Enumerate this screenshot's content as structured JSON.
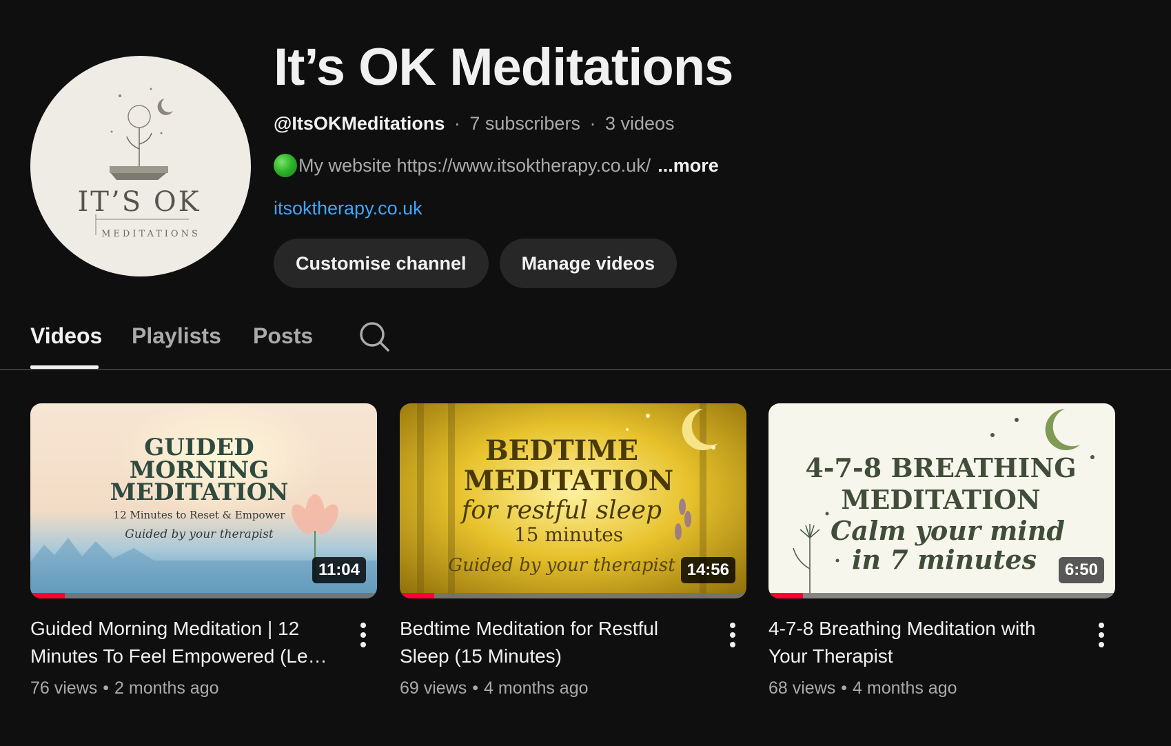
{
  "channel": {
    "title": "It’s OK Meditations",
    "handle": "@ItsOKMeditations",
    "subscribers": "7 subscribers",
    "videos_count": "3 videos",
    "description": "My website https://www.itsoktherapy.co.uk/",
    "more_label": "...more",
    "link": "itsoktherapy.co.uk",
    "avatar_text_main": "IT’S OK",
    "avatar_text_sub": "MEDITATIONS"
  },
  "actions": {
    "customise_label": "Customise channel",
    "manage_label": "Manage videos"
  },
  "tabs": [
    {
      "label": "Videos",
      "active": true
    },
    {
      "label": "Playlists",
      "active": false
    },
    {
      "label": "Posts",
      "active": false
    }
  ],
  "icons": {
    "search": "search-icon",
    "kebab": "more-vert-icon",
    "status_dot": "green-circle-icon"
  },
  "colors": {
    "background": "#0f0f0f",
    "link": "#3ea6ff",
    "progress": "#ff0033",
    "pill": "#272727"
  },
  "videos": [
    {
      "title": "Guided Morning Meditation | 12 Minutes To Feel Empowered (Led …",
      "views": "76 views",
      "age": "2 months ago",
      "duration": "11:04",
      "progress": 0.1,
      "thumb_lines": [
        "GUIDED",
        "MORNING",
        "MEDITATION",
        "12 Minutes to Reset & Empower",
        "Guided by your therapist"
      ]
    },
    {
      "title": "Bedtime Meditation for Restful Sleep (15 Minutes)",
      "views": "69 views",
      "age": "4 months ago",
      "duration": "14:56",
      "progress": 0.1,
      "thumb_lines": [
        "BEDTIME",
        "MEDITATION",
        "for restful sleep",
        "15 minutes",
        "Guided by your therapist"
      ]
    },
    {
      "title": "4-7-8 Breathing Meditation with Your Therapist",
      "views": "68 views",
      "age": "4 months ago",
      "duration": "6:50",
      "progress": 0.1,
      "thumb_lines": [
        "4-7-8 BREATHING",
        "MEDITATION",
        "Calm your mind",
        "in 7 minutes"
      ]
    }
  ]
}
